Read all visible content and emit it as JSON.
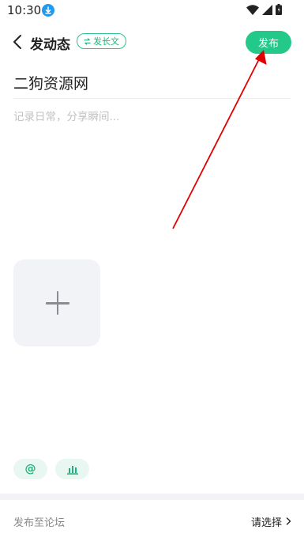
{
  "status_bar": {
    "time": "10:30"
  },
  "nav": {
    "title": "发动态",
    "long_article_label": "发长文",
    "publish_label": "发布"
  },
  "editor": {
    "title_value": "二狗资源网",
    "body_value": "",
    "body_placeholder": "记录日常，分享瞬间..."
  },
  "toolbar": {
    "mention_label": "@"
  },
  "forum": {
    "label": "发布至论坛",
    "value": "请选择"
  },
  "colors": {
    "accent": "#23c988",
    "annotation_arrow": "#e00000"
  }
}
